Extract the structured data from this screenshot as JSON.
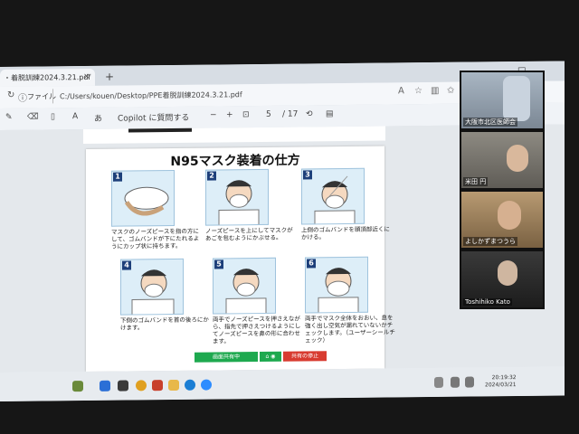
{
  "browser": {
    "tab_title": "・着脱訓練2024.3.21.pdf",
    "tab_close": "×",
    "new_tab": "+",
    "minimize": "—",
    "maximize": "□",
    "address_label": "ファイル",
    "address_url": "C:/Users/kouen/Desktop/PPE着脱訓練2024.3.21.pdf"
  },
  "pdf_toolbar": {
    "copilot_label": "Copilot に質問する",
    "zoom_out": "−",
    "zoom_in": "+",
    "page_current": "5",
    "page_total": "/ 17"
  },
  "document": {
    "title": "N95マスク装着の仕方",
    "steps": [
      {
        "num": "1",
        "text": "マスクのノーズピースを指の方にして、ゴムバンドが下にたれるようにカップ状に持ちます。"
      },
      {
        "num": "2",
        "text": "ノーズピースを上にしてマスクがあごを包むようにかぶせる。"
      },
      {
        "num": "3",
        "text": "上側のゴムバンドを頭頂部近くにかける。"
      },
      {
        "num": "4",
        "text": "下側のゴムバンドを首の後ろにかけます。"
      },
      {
        "num": "5",
        "text": "両手でノーズピースを押さえながら、指先で押さえつけるようにしてノーズピースを鼻の形に合わせます。"
      },
      {
        "num": "6",
        "text": "両手でマスク全体をおおい、息を強く出し空気が漏れていないかチェックします。（ユーザーシールチェック）"
      }
    ]
  },
  "sharing": {
    "sharing_label": "画面共有中",
    "stop_label": "共有の停止"
  },
  "participants": [
    {
      "name": "大阪市北区医師会"
    },
    {
      "name": "米田 円"
    },
    {
      "name": "よしかずまつうら"
    },
    {
      "name": "Toshihiko Kato"
    }
  ],
  "taskbar": {
    "time": "20:19:32",
    "date": "2024/03/21"
  },
  "colors": {
    "share_green": "#1ea94f",
    "share_red": "#d83b30",
    "step_number_bg": "#1d3f7a"
  }
}
